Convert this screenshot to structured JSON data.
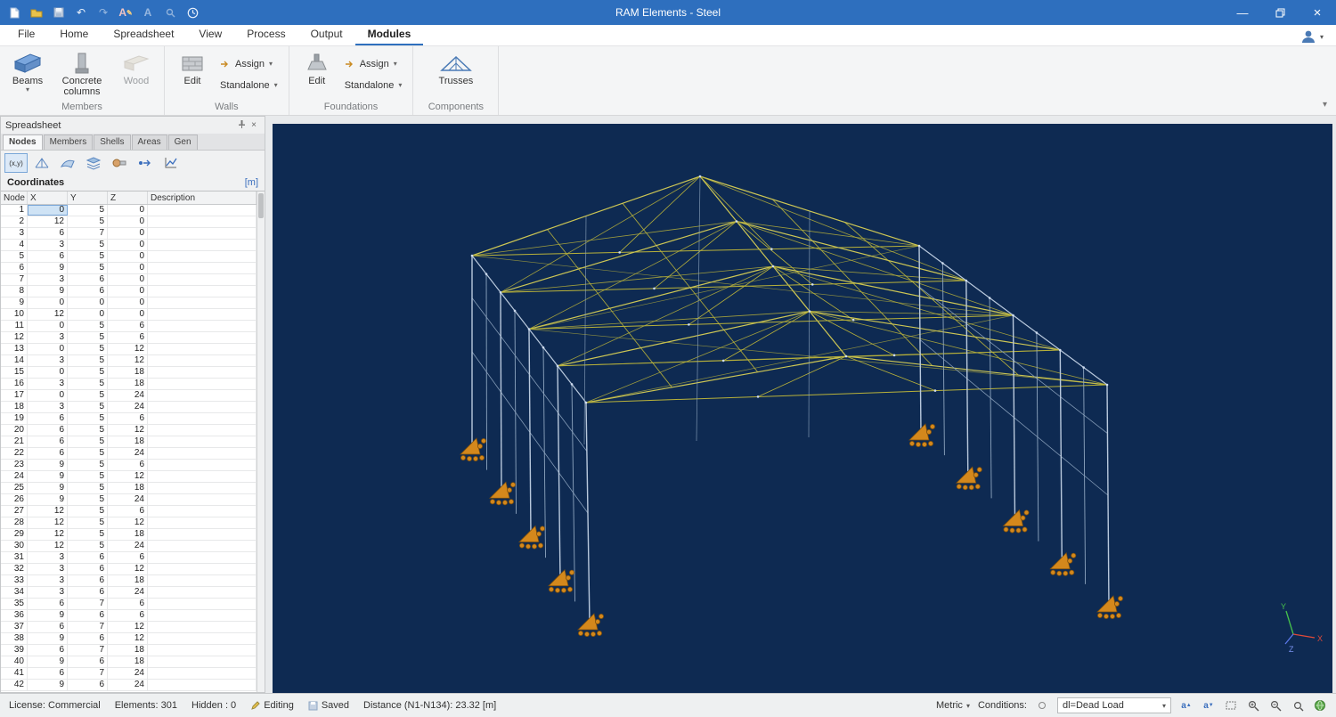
{
  "titlebar": {
    "title": "RAM Elements - Steel"
  },
  "menu": {
    "tabs": [
      "File",
      "Home",
      "Spreadsheet",
      "View",
      "Process",
      "Output",
      "Modules"
    ],
    "active": "Modules"
  },
  "ribbon": {
    "groups": [
      {
        "label": "Members",
        "items": [
          {
            "label": "Beams"
          },
          {
            "label": "Concrete columns"
          },
          {
            "label": "Wood"
          }
        ]
      },
      {
        "label": "Walls",
        "items": [
          {
            "label": "Edit"
          },
          {
            "label": "Assign"
          },
          {
            "label": "Standalone"
          }
        ]
      },
      {
        "label": "Foundations",
        "items": [
          {
            "label": "Edit"
          },
          {
            "label": "Assign"
          },
          {
            "label": "Standalone"
          }
        ]
      },
      {
        "label": "Components",
        "items": [
          {
            "label": "Trusses"
          }
        ]
      }
    ]
  },
  "panel": {
    "title": "Spreadsheet",
    "tabs": [
      "Nodes",
      "Members",
      "Shells",
      "Areas",
      "Gen"
    ],
    "active_tab": "Nodes",
    "xy_tool_label": "(x,y)",
    "section_title": "Coordinates",
    "units": "[m]",
    "table": {
      "headers": [
        "Node",
        "X",
        "Y",
        "Z",
        "Description"
      ],
      "rows": [
        [
          1,
          0,
          5,
          0
        ],
        [
          2,
          12,
          5,
          0
        ],
        [
          3,
          6,
          7,
          0
        ],
        [
          4,
          3,
          5,
          0
        ],
        [
          5,
          6,
          5,
          0
        ],
        [
          6,
          9,
          5,
          0
        ],
        [
          7,
          3,
          6,
          0
        ],
        [
          8,
          9,
          6,
          0
        ],
        [
          9,
          0,
          0,
          0
        ],
        [
          10,
          12,
          0,
          0
        ],
        [
          11,
          0,
          5,
          6
        ],
        [
          12,
          3,
          5,
          6
        ],
        [
          13,
          0,
          5,
          12
        ],
        [
          14,
          3,
          5,
          12
        ],
        [
          15,
          0,
          5,
          18
        ],
        [
          16,
          3,
          5,
          18
        ],
        [
          17,
          0,
          5,
          24
        ],
        [
          18,
          3,
          5,
          24
        ],
        [
          19,
          6,
          5,
          6
        ],
        [
          20,
          6,
          5,
          12
        ],
        [
          21,
          6,
          5,
          18
        ],
        [
          22,
          6,
          5,
          24
        ],
        [
          23,
          9,
          5,
          6
        ],
        [
          24,
          9,
          5,
          12
        ],
        [
          25,
          9,
          5,
          18
        ],
        [
          26,
          9,
          5,
          24
        ],
        [
          27,
          12,
          5,
          6
        ],
        [
          28,
          12,
          5,
          12
        ],
        [
          29,
          12,
          5,
          18
        ],
        [
          30,
          12,
          5,
          24
        ],
        [
          31,
          3,
          6,
          6
        ],
        [
          32,
          3,
          6,
          12
        ],
        [
          33,
          3,
          6,
          18
        ],
        [
          34,
          3,
          6,
          24
        ],
        [
          35,
          6,
          7,
          6
        ],
        [
          36,
          9,
          6,
          6
        ],
        [
          37,
          6,
          7,
          12
        ],
        [
          38,
          9,
          6,
          12
        ],
        [
          39,
          6,
          7,
          18
        ],
        [
          40,
          9,
          6,
          18
        ],
        [
          41,
          6,
          7,
          24
        ],
        [
          42,
          9,
          6,
          24
        ]
      ]
    }
  },
  "viewport": {
    "axis": {
      "x": "X",
      "y": "Y",
      "z": "Z"
    },
    "colors": {
      "background": "#0e2a52",
      "truss": "#b9b23a",
      "steel": "#b9c9dd",
      "support": "#d4881c"
    }
  },
  "statusbar": {
    "license": "License: Commercial",
    "elements": "Elements: 301",
    "hidden": "Hidden : 0",
    "editing": "Editing",
    "saved": "Saved",
    "distance": "Distance (N1-N134): 23.32 [m]",
    "units": "Metric",
    "conditions_label": "Conditions:",
    "condition_value": "dl=Dead Load"
  }
}
